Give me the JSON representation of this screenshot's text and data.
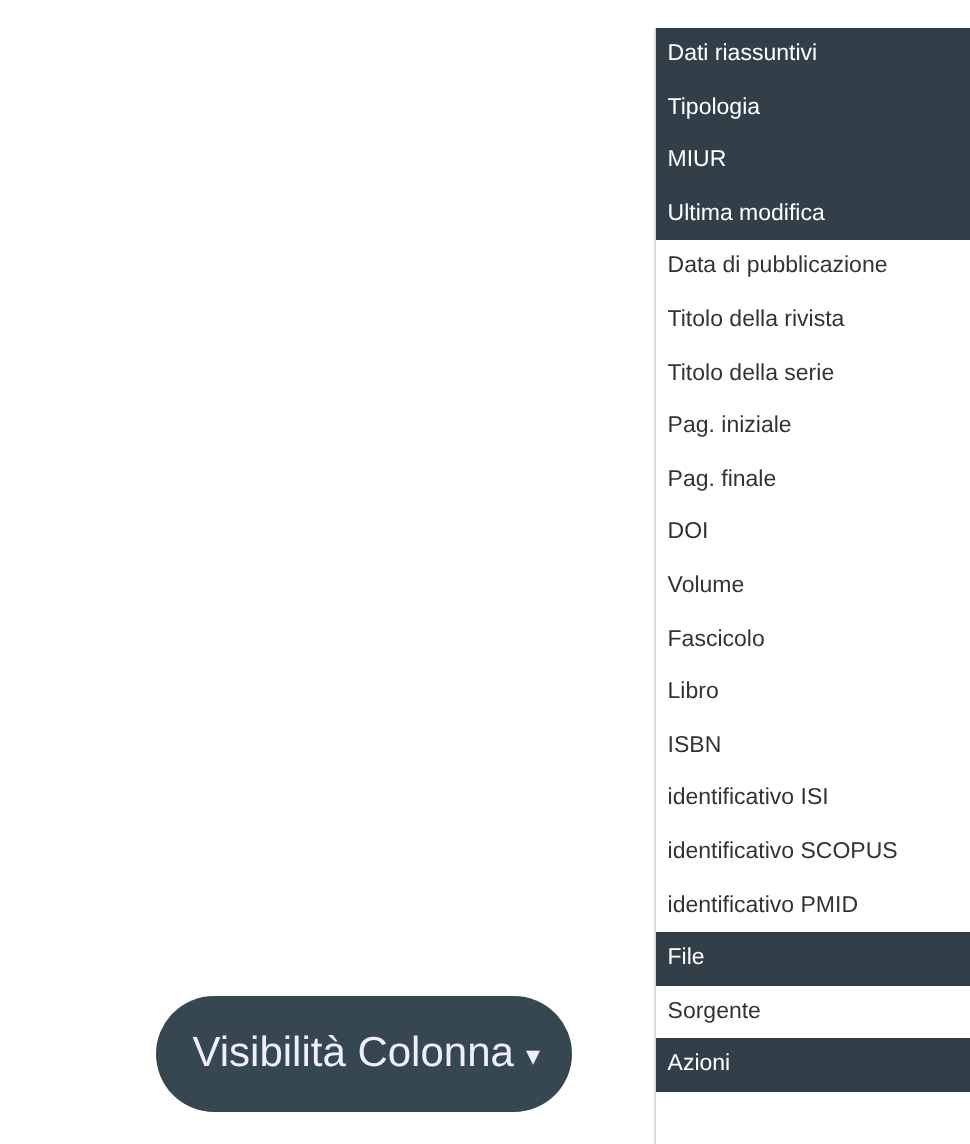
{
  "button": {
    "label": "Visibilità Colonna",
    "caret": "▾"
  },
  "menu": [
    {
      "label": "Dati riassuntivi",
      "selected": true
    },
    {
      "label": "Tipologia",
      "selected": true
    },
    {
      "label": "MIUR",
      "selected": true
    },
    {
      "label": "Ultima modifica",
      "selected": true
    },
    {
      "label": "Data di pubblicazione",
      "selected": false
    },
    {
      "label": "Titolo della rivista",
      "selected": false
    },
    {
      "label": "Titolo della serie",
      "selected": false
    },
    {
      "label": "Pag. iniziale",
      "selected": false
    },
    {
      "label": "Pag. finale",
      "selected": false
    },
    {
      "label": "DOI",
      "selected": false
    },
    {
      "label": "Volume",
      "selected": false
    },
    {
      "label": "Fascicolo",
      "selected": false
    },
    {
      "label": "Libro",
      "selected": false
    },
    {
      "label": "ISBN",
      "selected": false
    },
    {
      "label": "identificativo ISI",
      "selected": false
    },
    {
      "label": "identificativo SCOPUS",
      "selected": false
    },
    {
      "label": "identificativo PMID",
      "selected": false
    },
    {
      "label": "File",
      "selected": true
    },
    {
      "label": "Sorgente",
      "selected": false
    },
    {
      "label": "Azioni",
      "selected": true
    }
  ]
}
